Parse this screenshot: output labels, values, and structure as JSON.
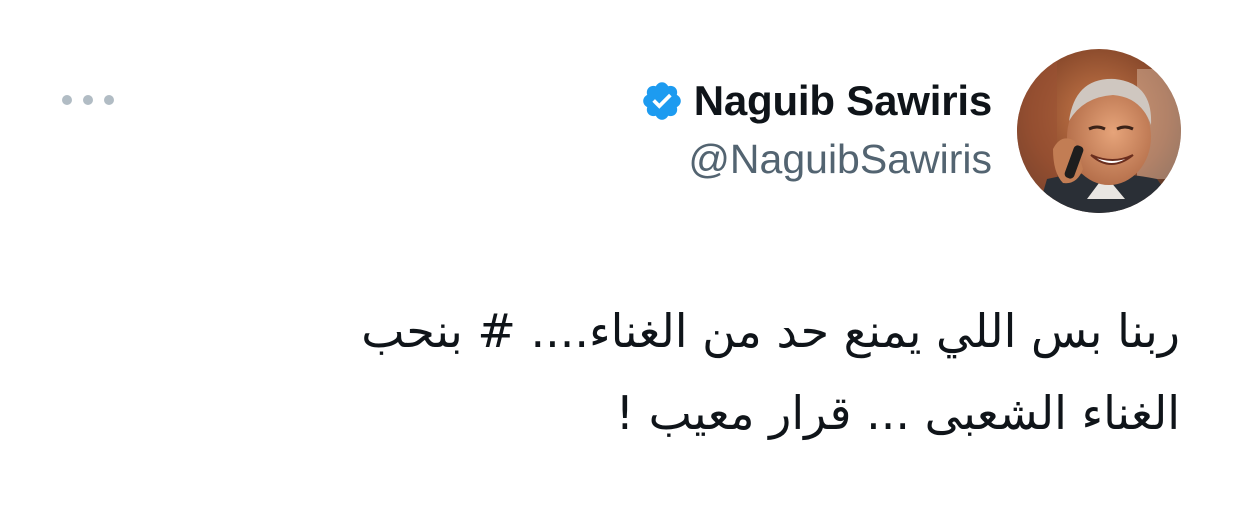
{
  "tweet": {
    "author": {
      "display_name": "Naguib Sawiris",
      "handle": "@NaguibSawiris",
      "verified": true,
      "avatar_icon": "avatar-photo"
    },
    "text_lines": [
      "ربنا بس اللي يمنع حد من الغناء.... # بنحب",
      "الغناء الشعبى ... قرار معيب !"
    ],
    "more_menu_icon": "more-horizontal-icon"
  },
  "colors": {
    "verified_badge": "#1d9bf0",
    "name": "#0f1419",
    "handle": "#536471",
    "more_dots": "#b1bcc4",
    "background": "#ffffff"
  }
}
